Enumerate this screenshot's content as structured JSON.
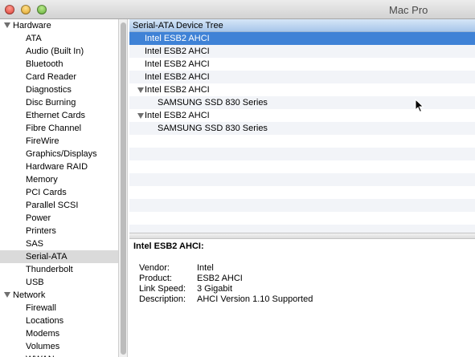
{
  "window": {
    "title": "Mac Pro"
  },
  "sidebar": {
    "rows": [
      {
        "kind": "cat",
        "label": "Hardware"
      },
      {
        "kind": "item",
        "label": "ATA"
      },
      {
        "kind": "item",
        "label": "Audio (Built In)"
      },
      {
        "kind": "item",
        "label": "Bluetooth"
      },
      {
        "kind": "item",
        "label": "Card Reader"
      },
      {
        "kind": "item",
        "label": "Diagnostics"
      },
      {
        "kind": "item",
        "label": "Disc Burning"
      },
      {
        "kind": "item",
        "label": "Ethernet Cards"
      },
      {
        "kind": "item",
        "label": "Fibre Channel"
      },
      {
        "kind": "item",
        "label": "FireWire"
      },
      {
        "kind": "item",
        "label": "Graphics/Displays"
      },
      {
        "kind": "item",
        "label": "Hardware RAID"
      },
      {
        "kind": "item",
        "label": "Memory"
      },
      {
        "kind": "item",
        "label": "PCI Cards"
      },
      {
        "kind": "item",
        "label": "Parallel SCSI"
      },
      {
        "kind": "item",
        "label": "Power"
      },
      {
        "kind": "item",
        "label": "Printers"
      },
      {
        "kind": "item",
        "label": "SAS"
      },
      {
        "kind": "item",
        "label": "Serial-ATA",
        "selected": true
      },
      {
        "kind": "item",
        "label": "Thunderbolt"
      },
      {
        "kind": "item",
        "label": "USB"
      },
      {
        "kind": "cat",
        "label": "Network"
      },
      {
        "kind": "item",
        "label": "Firewall"
      },
      {
        "kind": "item",
        "label": "Locations"
      },
      {
        "kind": "item",
        "label": "Modems"
      },
      {
        "kind": "item",
        "label": "Volumes"
      },
      {
        "kind": "item",
        "label": "WWAN"
      }
    ]
  },
  "tree": {
    "header": "Serial-ATA Device Tree",
    "rows": [
      {
        "label": "Intel ESB2 AHCI",
        "level": 1,
        "selected": true
      },
      {
        "label": "Intel ESB2 AHCI",
        "level": 1
      },
      {
        "label": "Intel ESB2 AHCI",
        "level": 1
      },
      {
        "label": "Intel ESB2 AHCI",
        "level": 1
      },
      {
        "label": "Intel ESB2 AHCI",
        "level": 1,
        "expanded": true
      },
      {
        "label": "SAMSUNG SSD 830 Series",
        "level": 2
      },
      {
        "label": "Intel ESB2 AHCI",
        "level": 1,
        "expanded": true
      },
      {
        "label": "SAMSUNG SSD 830 Series",
        "level": 2
      },
      {
        "label": "",
        "level": 1
      },
      {
        "label": "",
        "level": 1
      },
      {
        "label": "",
        "level": 1
      },
      {
        "label": "",
        "level": 1
      },
      {
        "label": "",
        "level": 1
      },
      {
        "label": "",
        "level": 1
      },
      {
        "label": "",
        "level": 1
      },
      {
        "label": "",
        "level": 1
      }
    ]
  },
  "details": {
    "title": "Intel ESB2 AHCI:",
    "fields": [
      {
        "key": "Vendor:",
        "value": "Intel"
      },
      {
        "key": "Product:",
        "value": "ESB2 AHCI"
      },
      {
        "key": "Link Speed:",
        "value": "3 Gigabit"
      },
      {
        "key": "Description:",
        "value": "AHCI Version 1.10 Supported"
      }
    ]
  },
  "colors": {
    "selection": "#3f82d6",
    "sidebar_selection": "#dadada"
  }
}
